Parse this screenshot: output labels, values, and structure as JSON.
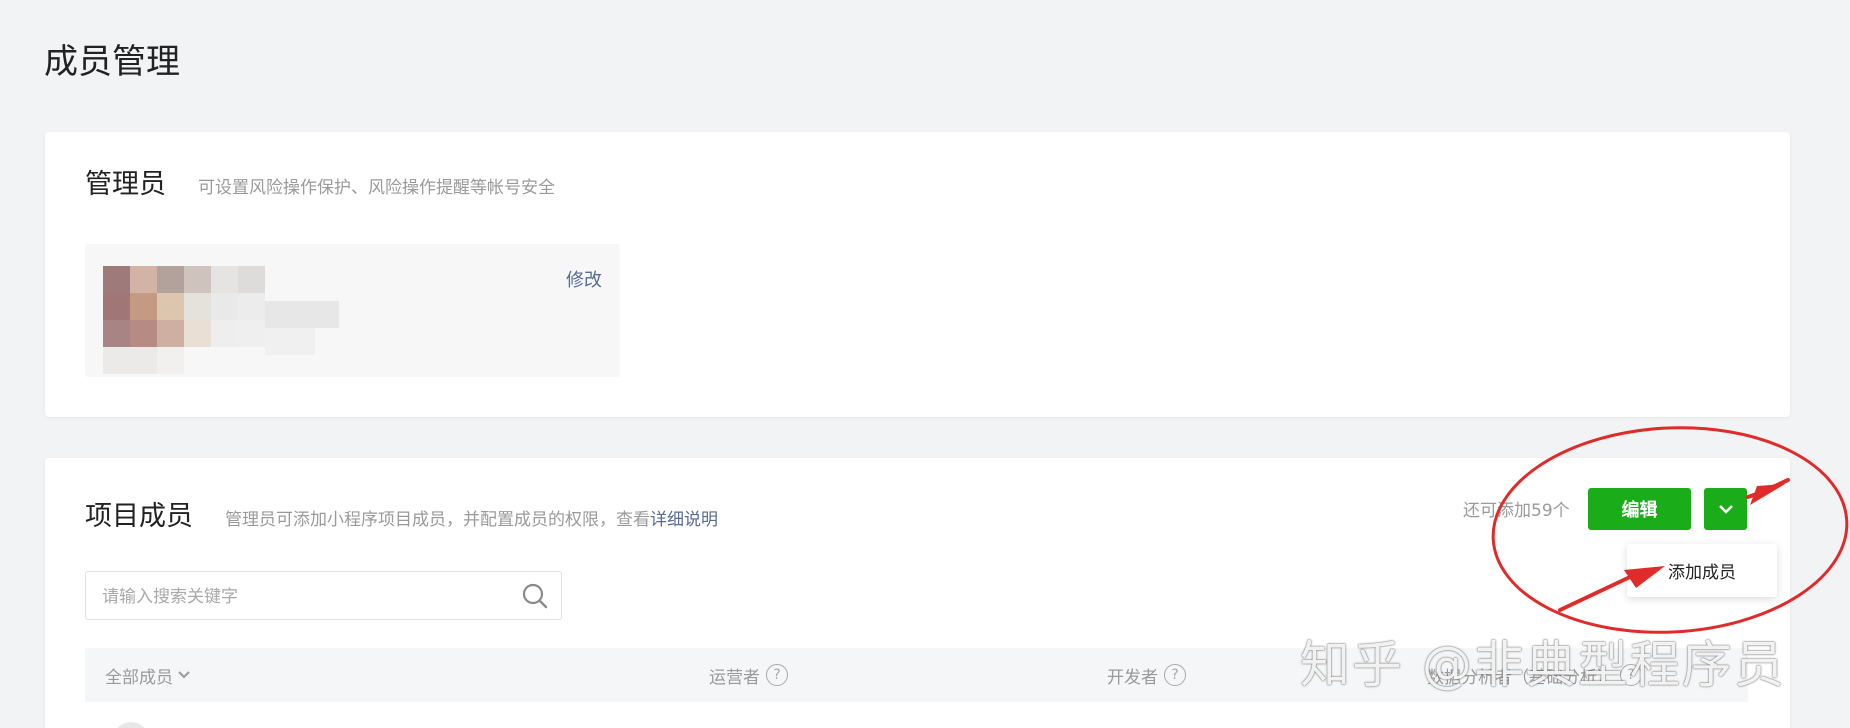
{
  "page_title": "成员管理",
  "admin_card": {
    "title": "管理员",
    "description": "可设置风险操作保护、风险操作提醒等帐号安全",
    "modify_label": "修改"
  },
  "members_card": {
    "title": "项目成员",
    "description": "管理员可添加小程序项目成员，并配置成员的权限，查看",
    "description_link": "详细说明",
    "quota_text": "还可添加59个",
    "edit_label": "编辑",
    "dropdown_item": "添加成员",
    "search_placeholder": "请输入搜索关键字",
    "columns": {
      "all_members": "全部成员",
      "operator": "运营者",
      "developer": "开发者",
      "data_analyst": "数据分析者（基础分析）"
    }
  },
  "watermark": "知乎 @非典型程序员",
  "colors": {
    "primary_green": "#1aad19",
    "link_blue": "#576b95",
    "annotation_red": "#e02b2b"
  }
}
